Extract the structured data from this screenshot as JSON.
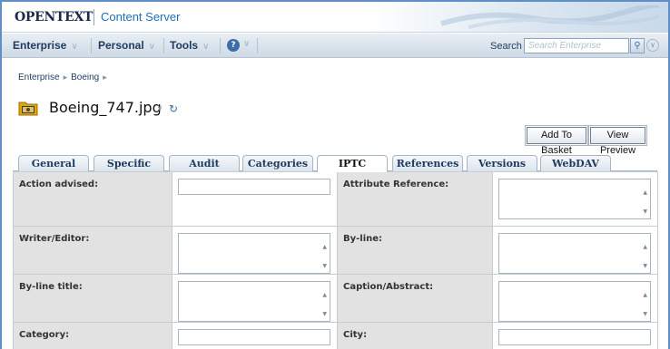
{
  "header": {
    "logo_text": "OPENTEXT",
    "product_name": "Content Server"
  },
  "nav": {
    "items": [
      "Enterprise",
      "Personal",
      "Tools"
    ],
    "help_icon": "help-circle-icon",
    "search_label": "Search",
    "search_placeholder": "Search Enterprise"
  },
  "breadcrumb": [
    "Enterprise",
    "Boeing"
  ],
  "page": {
    "title": "Boeing_747.jpg",
    "icon": "folder-image-icon"
  },
  "buttons": {
    "add_to_basket": "Add To Basket",
    "view_preview": "View Preview"
  },
  "tabs": [
    {
      "label": "General",
      "active": false
    },
    {
      "label": "Specific",
      "active": false
    },
    {
      "label": "Audit",
      "active": false
    },
    {
      "label": "Categories",
      "active": false
    },
    {
      "label": "IPTC",
      "active": true
    },
    {
      "label": "References",
      "active": false
    },
    {
      "label": "Versions",
      "active": false
    },
    {
      "label": "WebDAV",
      "active": false
    }
  ],
  "form": {
    "rows": [
      {
        "left": {
          "label": "Action advised:",
          "type": "text",
          "value": ""
        },
        "right": {
          "label": "Attribute Reference:",
          "type": "textarea",
          "value": ""
        }
      },
      {
        "left": {
          "label": "Writer/Editor:",
          "type": "textarea",
          "value": ""
        },
        "right": {
          "label": "By-line:",
          "type": "textarea",
          "value": ""
        }
      },
      {
        "left": {
          "label": "By-line title:",
          "type": "textarea",
          "value": ""
        },
        "right": {
          "label": "Caption/Abstract:",
          "type": "textarea",
          "value": ""
        }
      },
      {
        "left": {
          "label": "Category:",
          "type": "text",
          "value": ""
        },
        "right": {
          "label": "City:",
          "type": "text",
          "value": ""
        }
      }
    ]
  },
  "colors": {
    "frame_border": "#5e8fc6",
    "nav_text": "#1d3a5f",
    "product_blue": "#1e6fb8",
    "label_bg": "#e2e2e2"
  }
}
